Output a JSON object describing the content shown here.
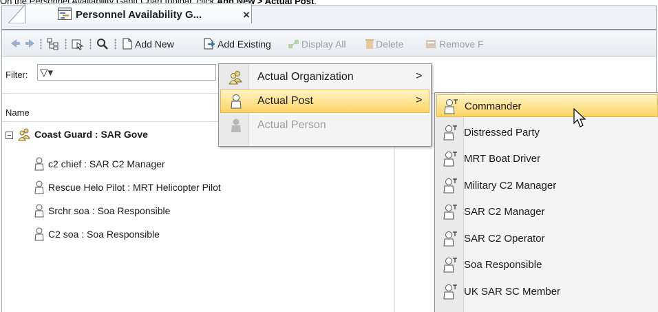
{
  "instruction": {
    "prefix": "On the Personnel Availability Gantt Chart toolbar, click ",
    "bold1": "Add New",
    "sep": " > ",
    "bold2": "Actual Post",
    "suffix": "."
  },
  "tab": {
    "title": "Personnel Availability G...",
    "close": "×"
  },
  "toolbar": {
    "add_new": "Add New",
    "add_existing": "Add Existing",
    "display_all": "Display All",
    "delete": "Delete",
    "remove": "Remove F"
  },
  "filter": {
    "label": "Filter:",
    "icon": "▽▾"
  },
  "table": {
    "header": "Name",
    "root": {
      "expander": "−",
      "label": "Coast Guard : SAR Gove"
    },
    "rows": [
      "c2 chief : SAR C2 Manager",
      "Rescue Helo Pilot : MRT Helicopter Pilot",
      "Srchr soa : Soa Responsible",
      "C2 soa : Soa Responsible"
    ]
  },
  "menu_add_new": {
    "items": [
      {
        "label": "Actual Organization",
        "arrow": ">",
        "icon": "organization-icon",
        "state": "normal"
      },
      {
        "label": "Actual Post",
        "arrow": ">",
        "icon": "post-icon",
        "state": "highlighted"
      },
      {
        "label": "Actual Person",
        "arrow": "",
        "icon": "person-icon",
        "state": "disabled"
      }
    ]
  },
  "menu_actual_post": {
    "items": [
      "Commander",
      "Distressed Party",
      "MRT Boat Driver",
      "Military C2 Manager",
      "SAR C2 Manager",
      "SAR C2 Operator",
      "Soa Responsible",
      "UK SAR SC Member"
    ],
    "highlighted_index": 0
  },
  "colors": {
    "highlight": "#fbd564",
    "highlight_border": "#e5b64a",
    "toolbar_bg": "#e6ebf0",
    "disabled_text": "#9aa1a8"
  }
}
